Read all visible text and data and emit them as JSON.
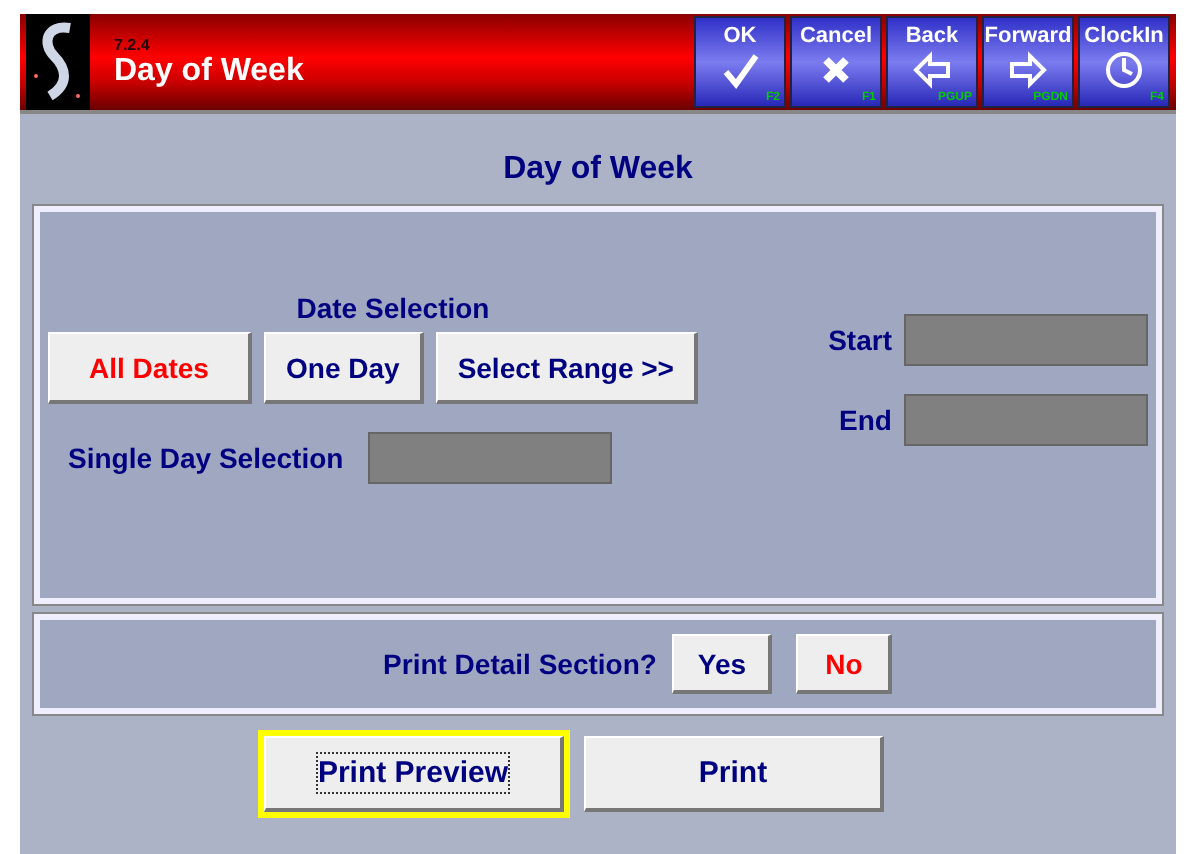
{
  "header": {
    "version": "7.2.4",
    "title": "Day of Week",
    "buttons": [
      {
        "label": "OK",
        "kind": "check",
        "key": "F2"
      },
      {
        "label": "Cancel",
        "kind": "cross",
        "key": "F1"
      },
      {
        "label": "Back",
        "kind": "left",
        "key": "PGUP"
      },
      {
        "label": "Forward",
        "kind": "right",
        "key": "PGDN"
      },
      {
        "label": "ClockIn",
        "kind": "clock",
        "key": "F4"
      }
    ]
  },
  "page_title": "Day of Week",
  "date_selection": {
    "label": "Date Selection",
    "options": [
      {
        "label": "All Dates",
        "selected": true
      },
      {
        "label": "One Day",
        "selected": false
      },
      {
        "label": "Select Range >>",
        "selected": false
      }
    ],
    "start_label": "Start",
    "end_label": "End",
    "single_day_label": "Single Day Selection"
  },
  "detail": {
    "label": "Print Detail Section?",
    "options": [
      {
        "label": "Yes",
        "selected": false
      },
      {
        "label": "No",
        "selected": true
      }
    ]
  },
  "actions": [
    {
      "label": "Print Preview",
      "focused": true
    },
    {
      "label": "Print",
      "focused": false
    }
  ]
}
